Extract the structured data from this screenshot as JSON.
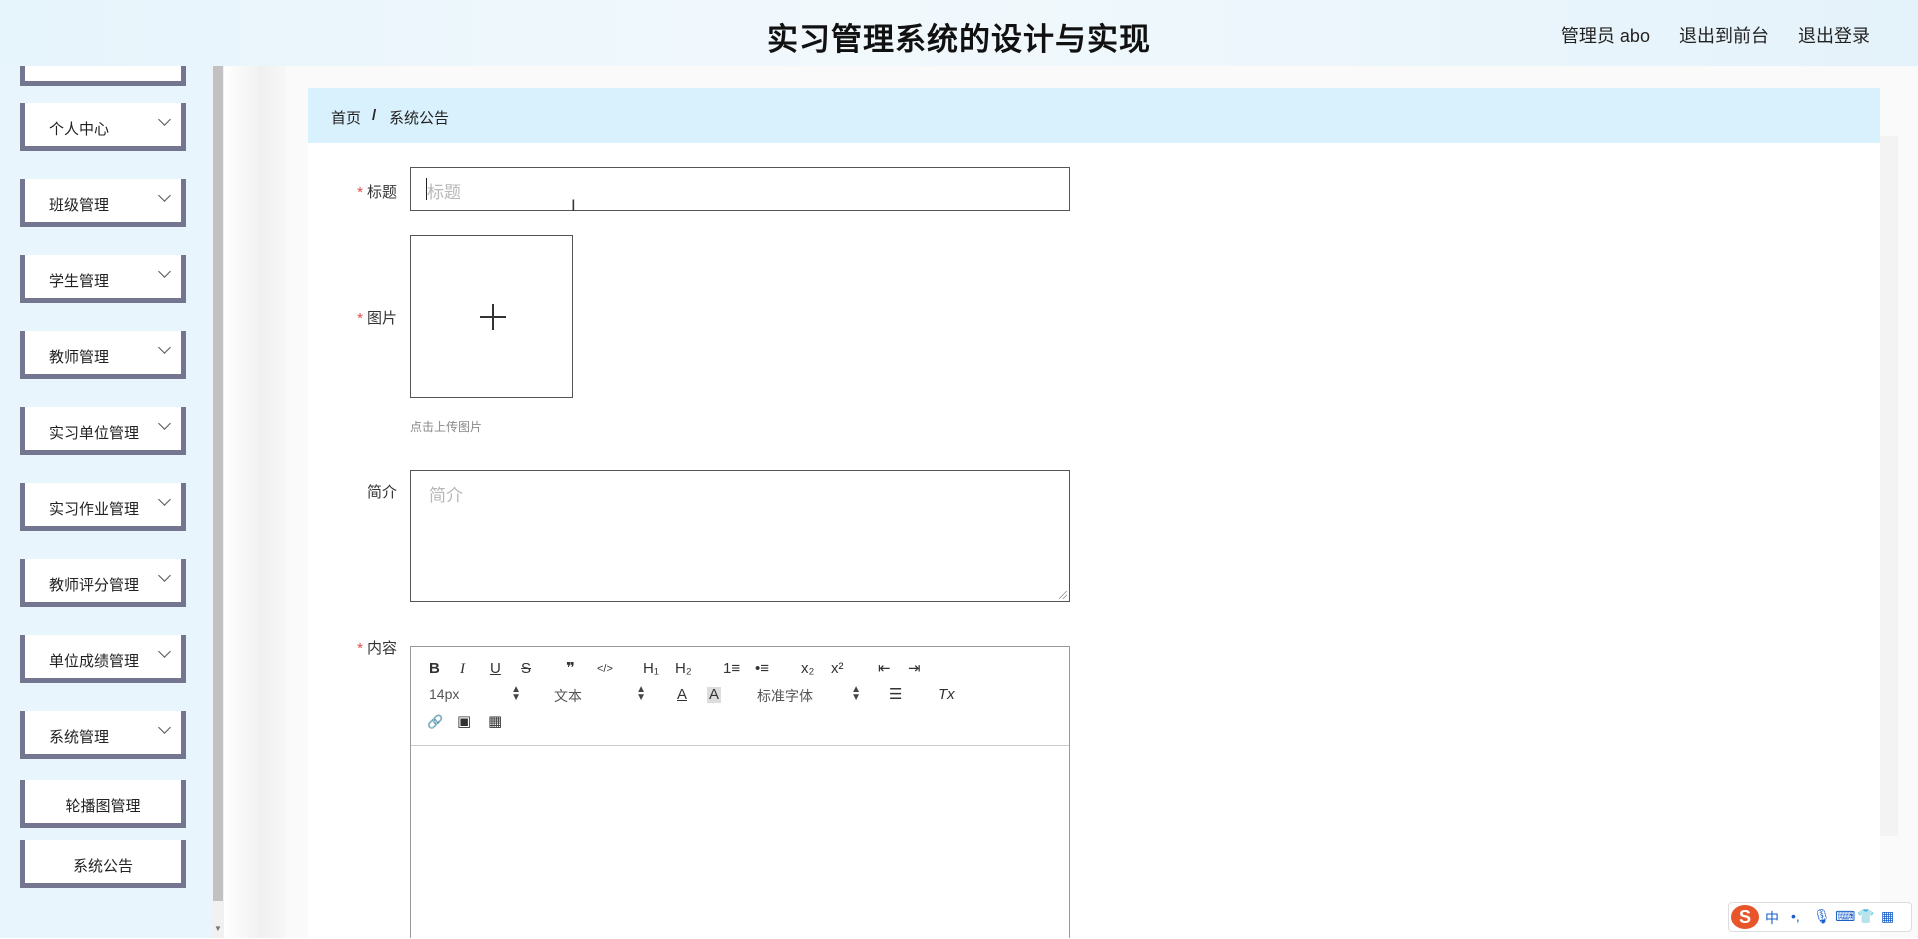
{
  "header": {
    "title": "实习管理系统的设计与实现",
    "admin": "管理员 abo",
    "exit_front": "退出到前台",
    "logout": "退出登录"
  },
  "sidebar": {
    "items": [
      {
        "label": "个人中心"
      },
      {
        "label": "班级管理"
      },
      {
        "label": "学生管理"
      },
      {
        "label": "教师管理"
      },
      {
        "label": "实习单位管理"
      },
      {
        "label": "实习作业管理"
      },
      {
        "label": "教师评分管理"
      },
      {
        "label": "单位成绩管理"
      },
      {
        "label": "系统管理"
      }
    ],
    "subitems": [
      {
        "label": "轮播图管理"
      },
      {
        "label": "系统公告"
      }
    ]
  },
  "breadcrumb": {
    "home": "首页",
    "sep": "/",
    "current": "系统公告"
  },
  "form": {
    "title_label": "标题",
    "title_placeholder": "标题",
    "image_label": "图片",
    "upload_tip": "点击上传图片",
    "intro_label": "简介",
    "intro_placeholder": "简介",
    "content_label": "内容",
    "required_mark": "*"
  },
  "editor": {
    "font_size": "14px",
    "header_select": "文本",
    "font_family": "标准字体",
    "buttons": {
      "bold": "B",
      "italic": "I",
      "underline": "U",
      "strike": "S",
      "quote": "❞",
      "code": "</>",
      "h1": "H₁",
      "h2": "H₂",
      "ordered_list": "1≡",
      "bullet_list": "•≡",
      "subscript": "x₂",
      "superscript": "x²",
      "outdent": "⇤",
      "indent": "⇥",
      "color": "A",
      "background": "A",
      "align": "☰",
      "clean": "Tx",
      "link": "🔗",
      "image": "▣",
      "video": "▦"
    }
  },
  "ime": {
    "logo": "S",
    "lang": "中"
  }
}
